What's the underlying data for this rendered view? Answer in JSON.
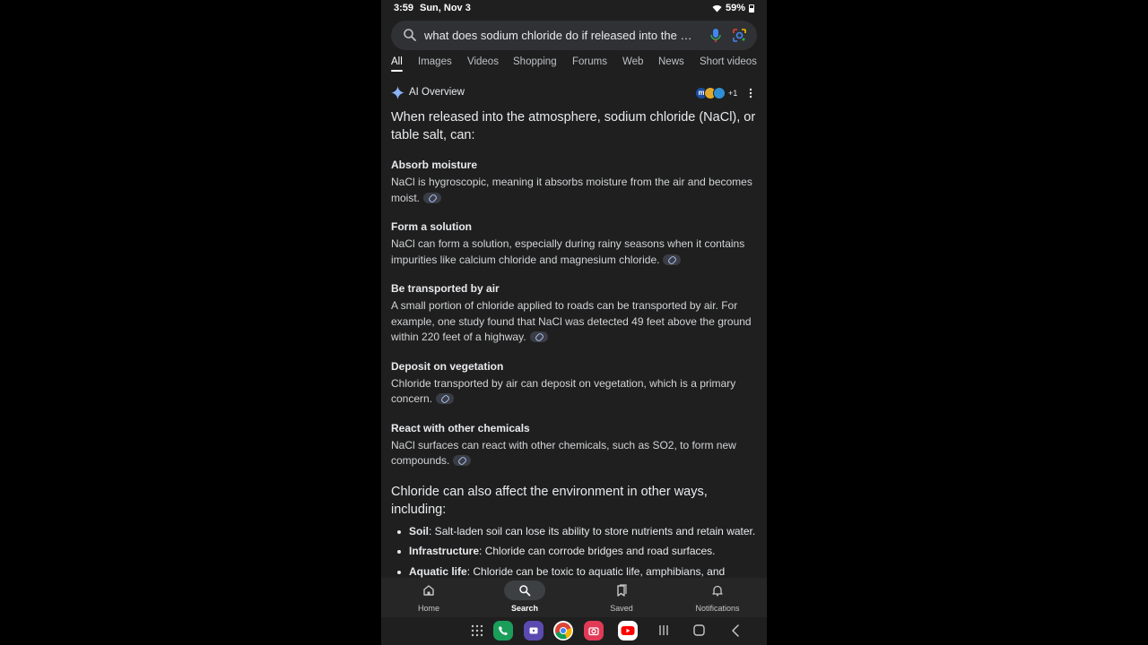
{
  "status": {
    "time": "3:59",
    "date": "Sun, Nov 3",
    "battery": "59%"
  },
  "search": {
    "query": "what does sodium chloride do if released into the a..."
  },
  "tabs": [
    "All",
    "Images",
    "Videos",
    "Shopping",
    "Forums",
    "Web",
    "News",
    "Short videos"
  ],
  "ai": {
    "label": "AI Overview",
    "sources_more": "+1",
    "intro": "When released into the atmosphere, sodium chloride (NaCl), or table salt, can:",
    "sections": [
      {
        "title": "Absorb moisture",
        "text": "NaCl is hygroscopic, meaning it absorbs moisture from the air and becomes moist."
      },
      {
        "title": "Form a solution",
        "text": "NaCl can form a solution, especially during rainy seasons when it contains impurities like calcium chloride and magnesium chloride."
      },
      {
        "title": "Be transported by air",
        "text": "A small portion of chloride applied to roads can be transported by air. For example, one study found that NaCl was detected 49 feet above the ground within 220 feet of a highway."
      },
      {
        "title": "Deposit on vegetation",
        "text": "Chloride transported by air can deposit on vegetation, which is a primary concern."
      },
      {
        "title": "React with other chemicals",
        "text": "NaCl surfaces can react with other chemicals, such as SO2, to form new compounds."
      }
    ],
    "subheading": "Chloride can also affect the environment in other ways, including:",
    "bullets": [
      {
        "term": "Soil",
        "text": ": Salt-laden soil can lose its ability to store nutrients and retain water."
      },
      {
        "term": "Infrastructure",
        "text": ": Chloride can corrode bridges and road surfaces."
      },
      {
        "term": "Aquatic life",
        "text": ": Chloride can be toxic to aquatic life, amphibians, and"
      }
    ]
  },
  "bottom_nav": {
    "home": "Home",
    "search": "Search",
    "saved": "Saved",
    "notifications": "Notifications"
  },
  "colors": {
    "background": "#1f1f1f",
    "search_bar": "#303134",
    "accent": "#8ab4f8"
  }
}
